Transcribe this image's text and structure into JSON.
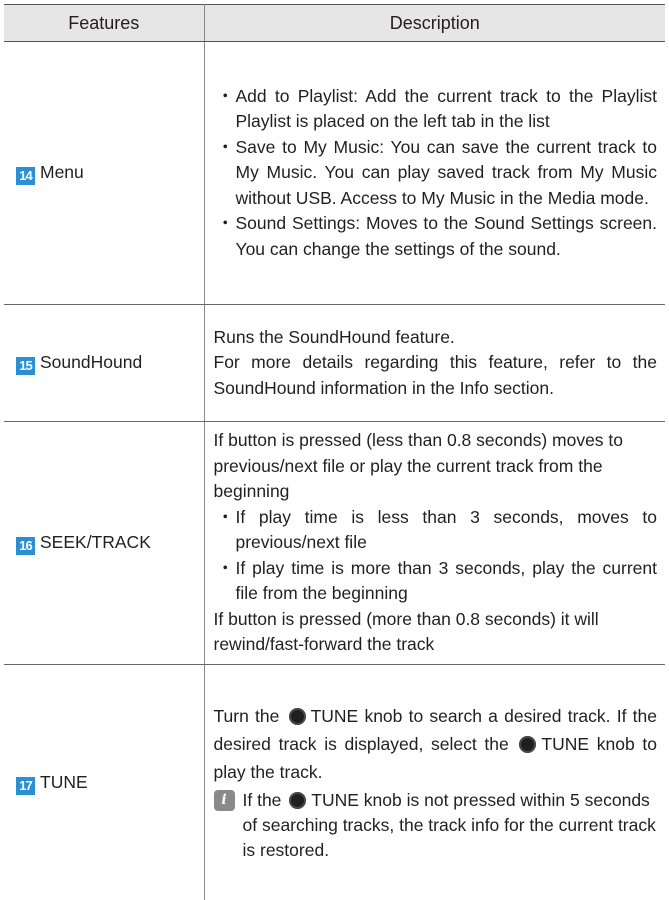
{
  "table": {
    "headers": [
      "Features",
      "Description"
    ],
    "rows": [
      {
        "number": "14",
        "feature": "Menu",
        "bullets": [
          "Add to Playlist: Add the current track to the Playlist Playlist is placed on the left tab in the list",
          "Save to My Music: You can save the current track to My Music. You can play saved track from My Music without USB.  Access to My Music in the Media mode.",
          "Sound Settings: Moves to the Sound Settings screen. You can change the settings of the sound."
        ]
      },
      {
        "number": "15",
        "feature": "SoundHound",
        "lines": [
          "Runs the SoundHound feature.",
          "For more details regarding this feature, refer to the SoundHound information in the Info section."
        ]
      },
      {
        "number": "16",
        "feature": "SEEK/TRACK",
        "intro": "If button is pressed (less than 0.8 seconds) moves to previous/next file or play the current track from the beginning",
        "bullets": [
          "If play time is less than 3 seconds, moves to previous/next file",
          "If play time is more than 3 seconds, play the current file from the beginning"
        ],
        "outro": "If button is pressed (more than 0.8 seconds) it will rewind/fast-forward the track"
      },
      {
        "number": "17",
        "feature": "TUNE",
        "line1_a": "Turn the",
        "line1_b": "TUNE knob to search a desired track. If the desired track is displayed, select the",
        "line1_c": "TUNE knob to play the track.",
        "note_a": "If the",
        "note_b": "TUNE knob is not pressed within 5 seconds of searching tracks, the track info for the current track is restored.",
        "info_icon": "i"
      }
    ]
  },
  "bullet_char": "・",
  "colors": {
    "number_badge": "#2b8fd6",
    "header_bg": "#e6e6e6",
    "info_icon": "#8a8a8a"
  },
  "icons": {
    "knob": "tune-knob-icon",
    "info": "info-icon"
  }
}
